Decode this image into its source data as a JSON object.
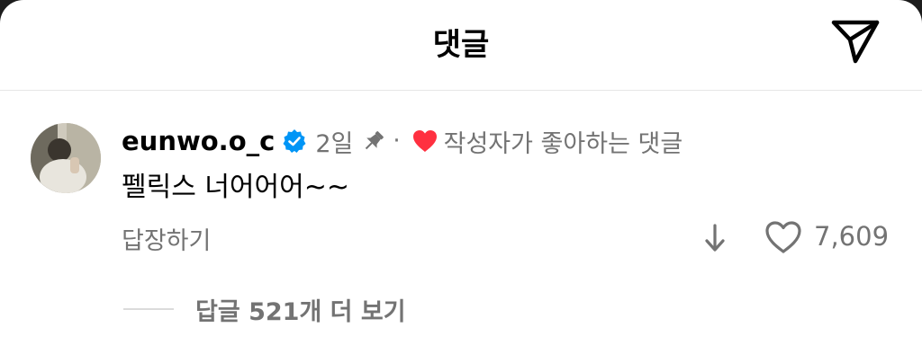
{
  "header": {
    "title": "댓글",
    "share_icon": "send-icon"
  },
  "comment": {
    "username": "eunwo.o_c",
    "verified_icon": "verified-badge-icon",
    "time": "2일",
    "pinned_icon": "pin-icon",
    "separator": "·",
    "liked_icon": "heart-filled-icon",
    "liked_by_author": "작성자가 좋아하는 댓글",
    "text": "펠릭스 너어어어~~",
    "reply_label": "답장하기",
    "download_icon": "arrow-down-icon",
    "like_icon": "heart-outline-icon",
    "like_count": "7,609",
    "view_replies": "답글 521개 더 보기"
  },
  "colors": {
    "secondary_text": "#737373",
    "verified_blue": "#0095f6",
    "heart_red": "#ff3040",
    "divider": "#e6e6e6"
  }
}
